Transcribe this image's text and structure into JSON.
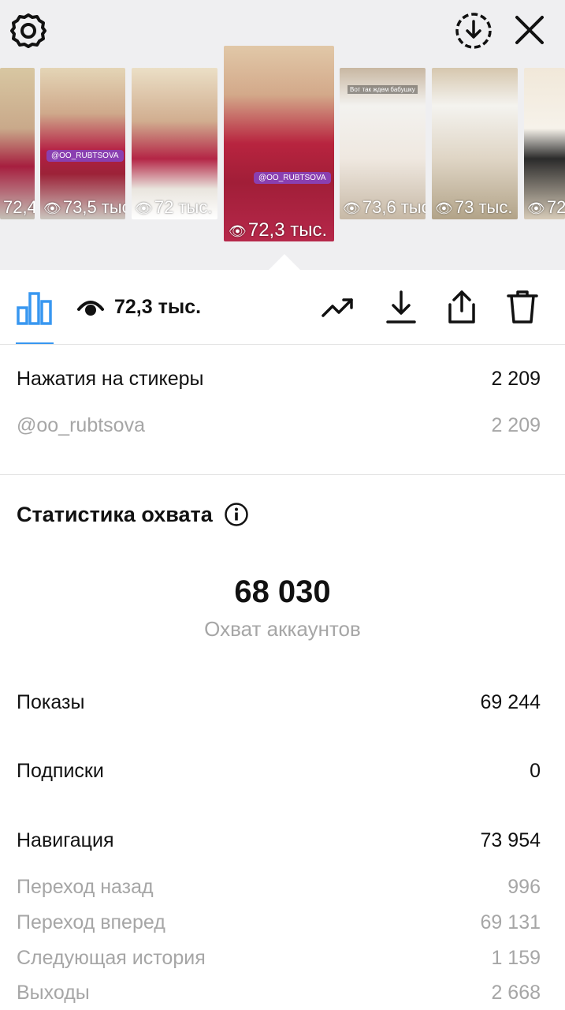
{
  "top_bar": {
    "settings_icon": "gear-icon",
    "download_all_icon": "download-circle-icon",
    "close_icon": "close-icon"
  },
  "stories": [
    {
      "views": "72,4 тыс.",
      "selected": false
    },
    {
      "views": "73,5 тыс.",
      "selected": false,
      "sticker_tag": "@OO_RUBTSOVA"
    },
    {
      "views": "72 тыс.",
      "selected": false
    },
    {
      "views": "72,3 тыс.",
      "selected": true,
      "sticker_tag": "@OO_RUBTSOVA"
    },
    {
      "views": "73,6 тыс.",
      "selected": false,
      "top_text": "Вот так ждем бабушку"
    },
    {
      "views": "73 тыс.",
      "selected": false
    },
    {
      "views": "72",
      "selected": false
    }
  ],
  "toolbar": {
    "views_total": "72,3 тыс.",
    "icons": [
      "bar-chart-icon",
      "eye-icon",
      "trending-icon",
      "download-icon",
      "share-icon",
      "trash-icon"
    ],
    "accent": "#3897f0"
  },
  "sticker_taps": {
    "label": "Нажатия на стикеры",
    "value": "2 209",
    "items": [
      {
        "label": "@oo_rubtsova",
        "value": "2 209"
      }
    ]
  },
  "reach": {
    "title": "Статистика охвата",
    "accounts_reached_value": "68 030",
    "accounts_reached_label": "Охват аккаунтов",
    "impressions": {
      "label": "Показы",
      "value": "69 244"
    },
    "follows": {
      "label": "Подписки",
      "value": "0"
    },
    "navigation": {
      "label": "Навигация",
      "value": "73 954",
      "items": [
        {
          "label": "Переход назад",
          "value": "996"
        },
        {
          "label": "Переход вперед",
          "value": "69 131"
        },
        {
          "label": "Следующая история",
          "value": "1 159"
        },
        {
          "label": "Выходы",
          "value": "2 668"
        }
      ]
    }
  }
}
